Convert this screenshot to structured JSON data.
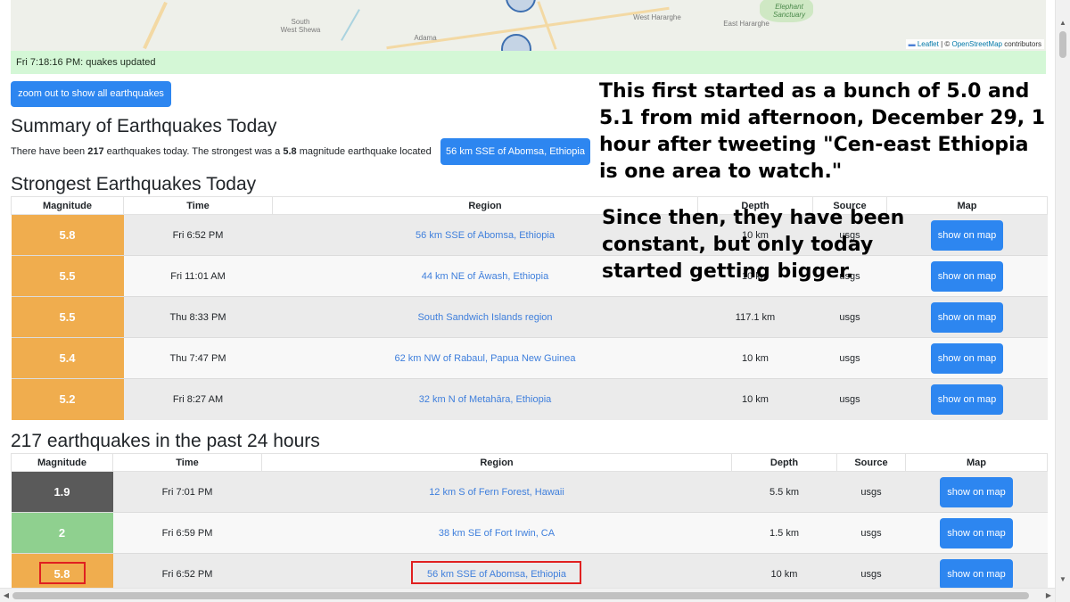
{
  "map": {
    "labels": {
      "south_west_shewa": "South\nWest Shewa",
      "adama": "Adama",
      "west_hararghe": "West Hararghe",
      "east_hararghe": "East Hararghe",
      "elephant_sanctuary": "Elephant\nSanctuary"
    },
    "attribution": {
      "leaflet": "Leaflet",
      "separator": " | © ",
      "osm": "OpenStreetMap",
      "contributors": " contributors"
    }
  },
  "status": {
    "text": "Fri 7:18:16 PM: quakes updated"
  },
  "zoom_button": {
    "label": "zoom out to show all earthquakes"
  },
  "summary": {
    "title": "Summary of Earthquakes Today",
    "prefix": "There have been ",
    "count": "217",
    "middle": " earthquakes today. The strongest was a ",
    "magnitude": "5.8",
    "suffix": " magnitude earthquake located",
    "location_button": "56 km SSE of Abomsa, Ethiopia"
  },
  "strongest": {
    "title": "Strongest Earthquakes Today",
    "headers": {
      "magnitude": "Magnitude",
      "time": "Time",
      "region": "Region",
      "depth": "Depth",
      "source": "Source",
      "map": "Map"
    },
    "rows": [
      {
        "magnitude": "5.8",
        "time": "Fri 6:52 PM",
        "region": "56 km SSE of Abomsa, Ethiopia",
        "depth": "10 km",
        "source": "usgs",
        "map": "show on map",
        "color": "#f0ad4e"
      },
      {
        "magnitude": "5.5",
        "time": "Fri 11:01 AM",
        "region": "44 km NE of Āwash, Ethiopia",
        "depth": "10 km",
        "source": "usgs",
        "map": "show on map",
        "color": "#f0ad4e"
      },
      {
        "magnitude": "5.5",
        "time": "Thu 8:33 PM",
        "region": "South Sandwich Islands region",
        "depth": "117.1 km",
        "source": "usgs",
        "map": "show on map",
        "color": "#f0ad4e"
      },
      {
        "magnitude": "5.4",
        "time": "Thu 7:47 PM",
        "region": "62 km NW of Rabaul, Papua New Guinea",
        "depth": "10 km",
        "source": "usgs",
        "map": "show on map",
        "color": "#f0ad4e"
      },
      {
        "magnitude": "5.2",
        "time": "Fri 8:27 AM",
        "region": "32 km N of Metahāra, Ethiopia",
        "depth": "10 km",
        "source": "usgs",
        "map": "show on map",
        "color": "#f0ad4e"
      }
    ]
  },
  "recent": {
    "title": "217 earthquakes in the past 24 hours",
    "headers": {
      "magnitude": "Magnitude",
      "time": "Time",
      "region": "Region",
      "depth": "Depth",
      "source": "Source",
      "map": "Map"
    },
    "rows": [
      {
        "magnitude": "1.9",
        "time": "Fri 7:01 PM",
        "region": "12 km S of Fern Forest, Hawaii",
        "depth": "5.5 km",
        "source": "usgs",
        "map": "show on map",
        "color": "#5a5a5a"
      },
      {
        "magnitude": "2",
        "time": "Fri 6:59 PM",
        "region": "38 km SE of Fort Irwin, CA",
        "depth": "1.5 km",
        "source": "usgs",
        "map": "show on map",
        "color": "#8fd08f"
      },
      {
        "magnitude": "5.8",
        "time": "Fri 6:52 PM",
        "region": "56 km SSE of Abomsa, Ethiopia",
        "depth": "10 km",
        "source": "usgs",
        "map": "show on map",
        "color": "#f0ad4e"
      }
    ]
  },
  "overlay": {
    "first": "This first started as a bunch of 5.0 and 5.1 from mid afternoon, December 29, 1 hour after tweeting \"Cen-east Ethiopia is one area to watch.\"",
    "second": "Since then, they have been constant, but only today started getting bigger."
  }
}
